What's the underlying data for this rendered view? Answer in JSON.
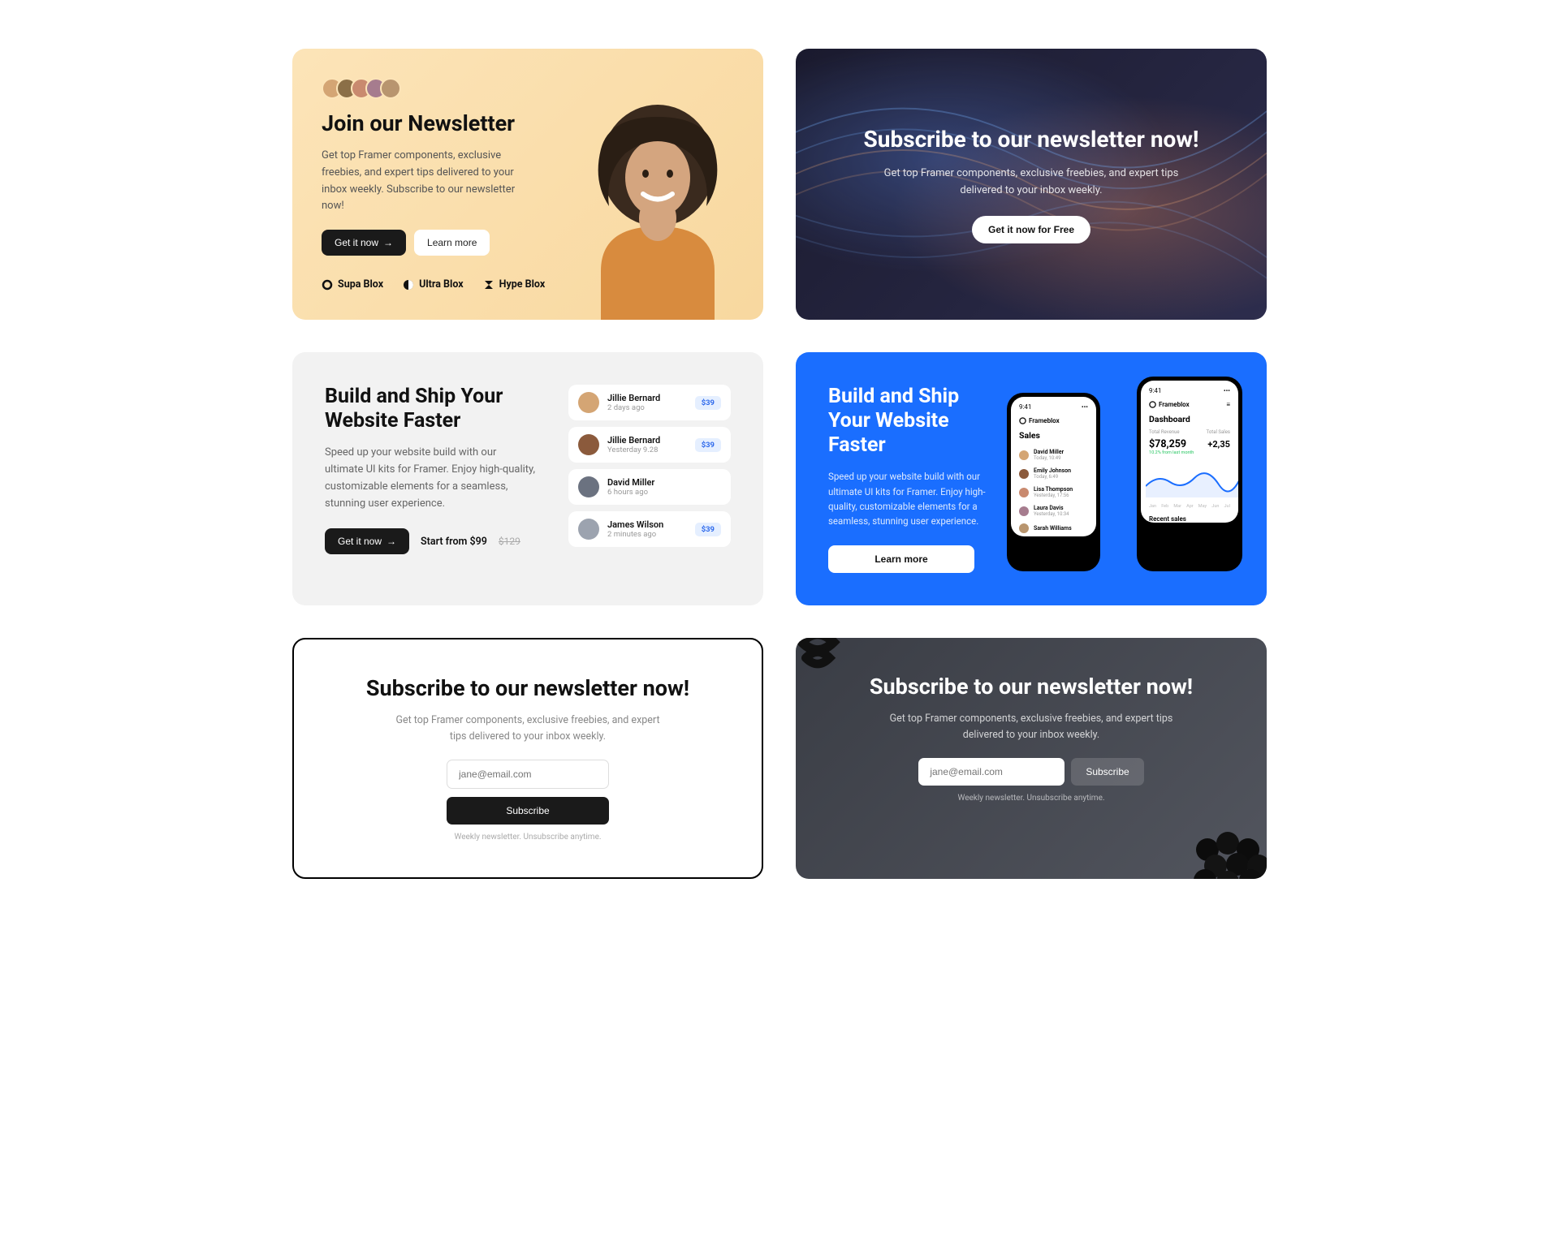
{
  "card1": {
    "title": "Join our Newsletter",
    "desc": "Get top Framer components, exclusive freebies, and expert tips delivered to your inbox weekly. Subscribe to our newsletter now!",
    "btn_primary": "Get it now",
    "btn_secondary": "Learn more",
    "brands": [
      "Supa Blox",
      "Ultra Blox",
      "Hype Blox"
    ],
    "avatar_colors": [
      "#d4a574",
      "#8b6f47",
      "#c98a6f",
      "#a67c8e",
      "#b8956f"
    ]
  },
  "card2": {
    "title": "Subscribe to our newsletter now!",
    "desc": "Get top Framer components, exclusive freebies, and expert tips delivered to your inbox weekly.",
    "btn": "Get it now for Free"
  },
  "card3": {
    "title": "Build and Ship Your Website Faster",
    "desc": "Speed up your website build with our ultimate UI kits for Framer. Enjoy high-quality, customizable elements for a seamless, stunning user experience.",
    "btn": "Get it now",
    "price": "Start from $99",
    "price_old": "$129",
    "users": [
      {
        "name": "Jillie Bernard",
        "time": "2 days ago",
        "badge": "$39",
        "color": "#d4a574"
      },
      {
        "name": "Jillie Bernard",
        "time": "Yesterday 9.28",
        "badge": "$39",
        "color": "#8b5a3c"
      },
      {
        "name": "David Miller",
        "time": "6 hours ago",
        "badge": "",
        "color": "#6b7280"
      },
      {
        "name": "James Wilson",
        "time": "2 minutes ago",
        "badge": "$39",
        "color": "#9ca3af"
      }
    ]
  },
  "card4": {
    "title": "Build and Ship Your Website Faster",
    "desc": "Speed up your website build with our ultimate UI kits for Framer. Enjoy high-quality, customizable elements for a seamless, stunning user experience.",
    "btn": "Learn more",
    "phone1": {
      "brand": "Frameblox",
      "title": "Sales",
      "items": [
        {
          "name": "David Miller",
          "sub": "Today, 10:49"
        },
        {
          "name": "Emily Johnson",
          "sub": "Today, 6:49"
        },
        {
          "name": "Lisa Thompson",
          "sub": "Yesterday, 17:56"
        },
        {
          "name": "Laura Davis",
          "sub": "Yesterday, 10:34"
        },
        {
          "name": "Sarah Williams",
          "sub": ""
        }
      ]
    },
    "phone2": {
      "brand": "Frameblox",
      "time": "9:41",
      "title": "Dashboard",
      "revenue_label": "Total Revenue",
      "revenue": "$78,259",
      "change": "10.2% from last month",
      "extra": "+2,35",
      "sales_label": "Total Sales",
      "months": [
        "Jan",
        "Feb",
        "Mar",
        "Apr",
        "May",
        "Jun",
        "Jul"
      ],
      "recent": "Recent sales"
    }
  },
  "card5": {
    "title": "Subscribe to our newsletter now!",
    "desc": "Get top Framer components, exclusive freebies, and expert tips delivered to your inbox weekly.",
    "placeholder": "jane@email.com",
    "btn": "Subscribe",
    "note": "Weekly newsletter. Unsubscribe anytime."
  },
  "card6": {
    "title": "Subscribe to our newsletter now!",
    "desc": "Get top Framer components, exclusive freebies, and expert tips delivered to your inbox weekly.",
    "placeholder": "jane@email.com",
    "btn": "Subscribe",
    "note": "Weekly newsletter. Unsubscribe anytime."
  }
}
